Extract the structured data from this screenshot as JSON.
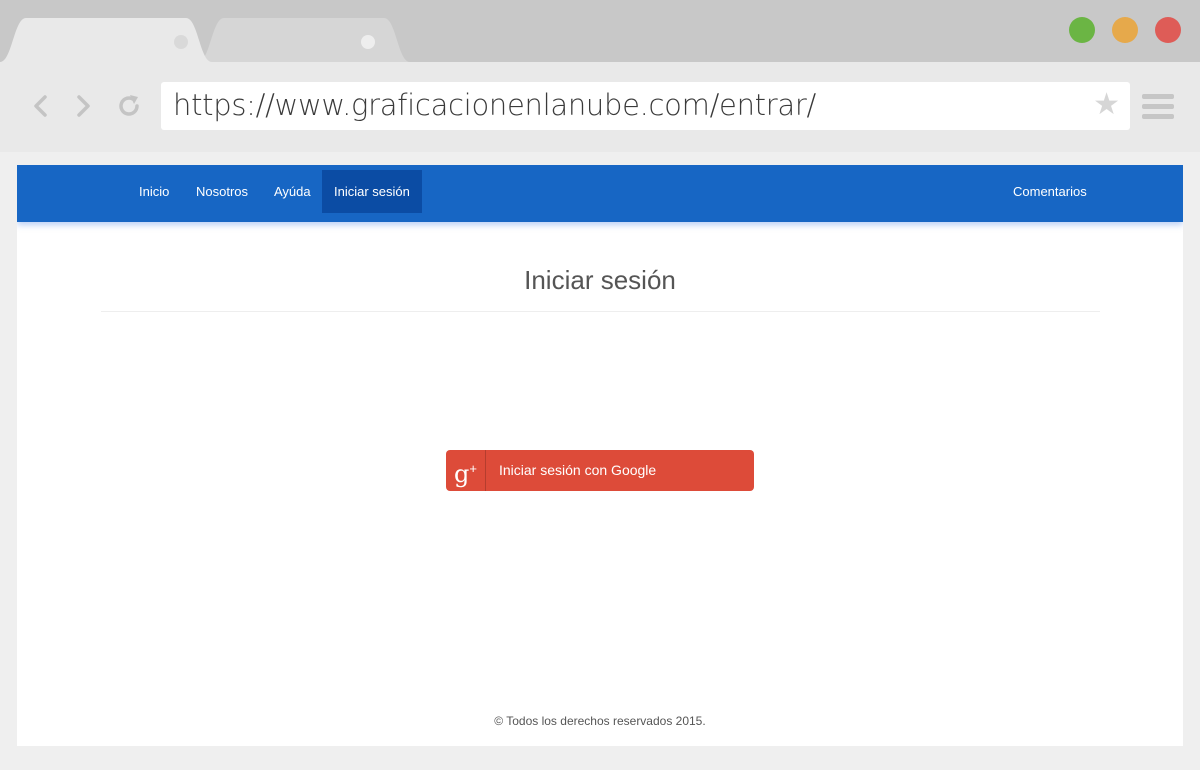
{
  "browser": {
    "url": "https://www.graficacionenlanube.com/entrar/",
    "icons": {
      "back": "chevron-left-icon",
      "forward": "chevron-right-icon",
      "reload": "reload-icon",
      "star": "★",
      "menu": "hamburger-menu-icon"
    },
    "window_buttons": {
      "green": "#6bb544",
      "yellow": "#e6a94b",
      "red": "#de5c57"
    }
  },
  "navbar": {
    "color": "#1766c4",
    "active_color": "#0b4ca4",
    "items": [
      {
        "label": "Inicio"
      },
      {
        "label": "Nosotros"
      },
      {
        "label": "Ayúda"
      },
      {
        "label": "Iniciar sesión",
        "active": true
      }
    ],
    "right_item": {
      "label": "Comentarios"
    }
  },
  "main": {
    "title": "Iniciar sesión",
    "google_button": {
      "icon_text": "g",
      "icon_sup": "+",
      "label": "Iniciar sesión con Google",
      "color": "#dd4b39"
    }
  },
  "footer": {
    "text": "© Todos los derechos reservados 2015."
  }
}
